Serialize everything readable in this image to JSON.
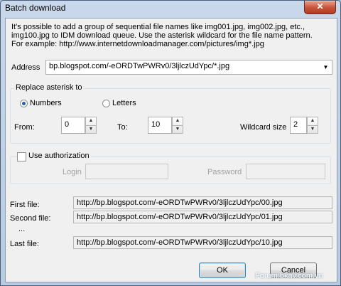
{
  "window": {
    "title": "Batch download",
    "close_glyph": "✕"
  },
  "info": {
    "line1": "It's possible to add a group of sequential file names like img001.jpg, img002.jpg, etc.,",
    "line2": "img100.jpg to IDM download queue. Use the asterisk wildcard for the file name pattern.",
    "line3": "For example:   http://www.internetdownloadmanager.com/pictures/img*.jpg"
  },
  "address": {
    "label": "Address",
    "value": "bp.blogspot.com/-eORDTwPWRv0/3ljlczUdYpc/*.jpg",
    "dropdown_glyph": "▼"
  },
  "replace": {
    "legend": "Replace asterisk to",
    "numbers_label": "Numbers",
    "letters_label": "Letters",
    "selected": "Numbers",
    "from_label": "From:",
    "from_value": "0",
    "to_label": "To:",
    "to_value": "10",
    "wildcard_label": "Wildcard size",
    "wildcard_value": "2",
    "spin_up": "▲",
    "spin_down": "▼"
  },
  "auth": {
    "checkbox_label": "Use authorization",
    "checked": false,
    "login_label": "Login",
    "password_label": "Password"
  },
  "results": {
    "first_label": "First file:",
    "first_value": "http://bp.blogspot.com/-eORDTwPWRv0/3ljlczUdYpc/00.jpg",
    "second_label": "Second file:",
    "second_value": "http://bp.blogspot.com/-eORDTwPWRv0/3ljlczUdYpc/01.jpg",
    "ellipsis": "...",
    "last_label": "Last file:",
    "last_value": "http://bp.blogspot.com/-eORDTwPWRv0/3ljlczUdYpc/10.jpg"
  },
  "buttons": {
    "ok": "OK",
    "cancel": "Cancel"
  },
  "watermark": "Forum.bkav.com.vn"
}
